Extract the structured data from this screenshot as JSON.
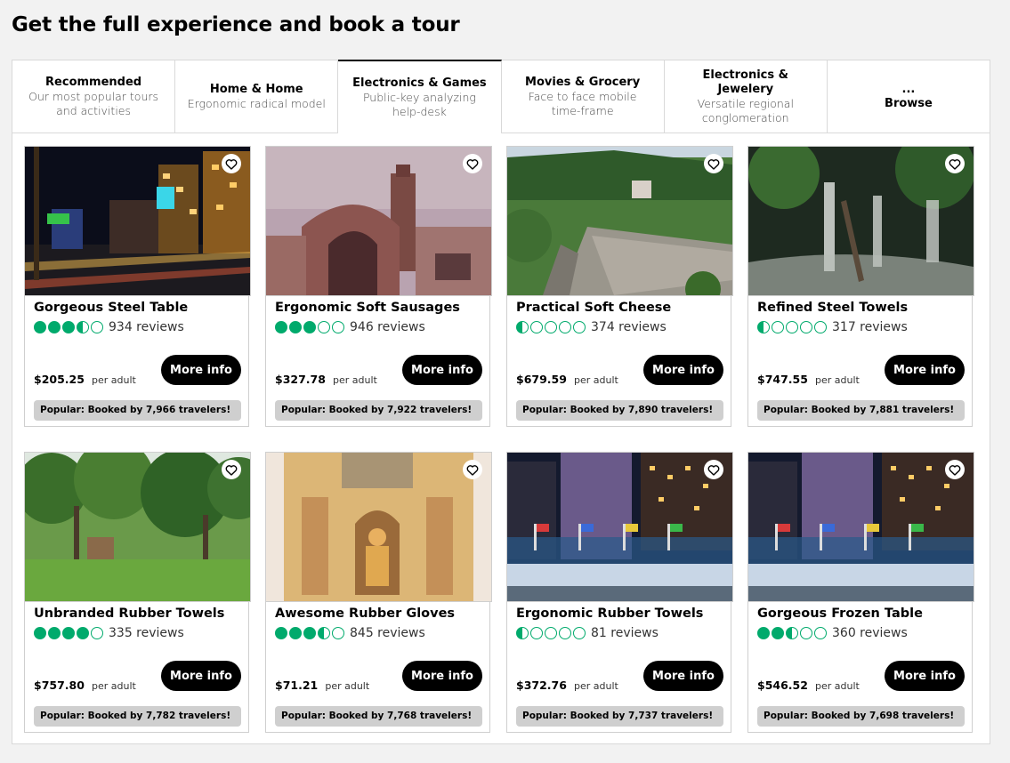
{
  "page": {
    "title": "Get the full experience and book a tour"
  },
  "tabs": [
    {
      "label": "Recommended",
      "sub": "Our most popular tours and activities",
      "active": false
    },
    {
      "label": "Home & Home",
      "sub": "Ergonomic radical model",
      "active": false
    },
    {
      "label": "Electronics & Games",
      "sub": "Public-key analyzing help-desk",
      "active": true
    },
    {
      "label": "Movies & Grocery",
      "sub": "Face to face mobile time-frame",
      "active": false
    },
    {
      "label": "Electronics & Jewelery",
      "sub": "Versatile regional conglomeration",
      "active": false
    },
    {
      "label": "...",
      "sub": "Browse",
      "active": false
    }
  ],
  "cards": [
    {
      "title": "Gorgeous Steel Table",
      "rating": 3.5,
      "reviews": "934 reviews",
      "price": "$205.25",
      "per": "per adult",
      "button": "More info",
      "popular": "Popular: Booked by 7,966 travelers!",
      "scene": "night-city"
    },
    {
      "title": "Ergonomic Soft Sausages",
      "rating": 3,
      "reviews": "946 reviews",
      "price": "$327.78",
      "per": "per adult",
      "button": "More info",
      "popular": "Popular: Booked by 7,922 travelers!",
      "scene": "station"
    },
    {
      "title": "Practical Soft Cheese",
      "rating": 0.5,
      "reviews": "374 reviews",
      "price": "$679.59",
      "per": "per adult",
      "button": "More info",
      "popular": "Popular: Booked by 7,890 travelers!",
      "scene": "bridge"
    },
    {
      "title": "Refined Steel Towels",
      "rating": 0.5,
      "reviews": "317 reviews",
      "price": "$747.55",
      "per": "per adult",
      "button": "More info",
      "popular": "Popular: Booked by 7,881 travelers!",
      "scene": "waterfall"
    },
    {
      "title": "Unbranded Rubber Towels",
      "rating": 4,
      "reviews": "335 reviews",
      "price": "$757.80",
      "per": "per adult",
      "button": "More info",
      "popular": "Popular: Booked by 7,782 travelers!",
      "scene": "forest"
    },
    {
      "title": "Awesome Rubber Gloves",
      "rating": 3.5,
      "reviews": "845 reviews",
      "price": "$71.21",
      "per": "per adult",
      "button": "More info",
      "popular": "Popular: Booked by 7,768 travelers!",
      "scene": "fountain"
    },
    {
      "title": "Ergonomic Rubber Towels",
      "rating": 0.5,
      "reviews": "81 reviews",
      "price": "$372.76",
      "per": "per adult",
      "button": "More info",
      "popular": "Popular: Booked by 7,737 travelers!",
      "scene": "plaza"
    },
    {
      "title": "Gorgeous Frozen Table",
      "rating": 2.5,
      "reviews": "360 reviews",
      "price": "$546.52",
      "per": "per adult",
      "button": "More info",
      "popular": "Popular: Booked by 7,698 travelers!",
      "scene": "plaza"
    }
  ],
  "colors": {
    "rating_green": "#00aa6c",
    "button_bg": "#000000",
    "popular_bg": "#cfcfcf"
  },
  "icons": {
    "favorite": "heart-icon",
    "rating": "rating-bubble-icon"
  }
}
